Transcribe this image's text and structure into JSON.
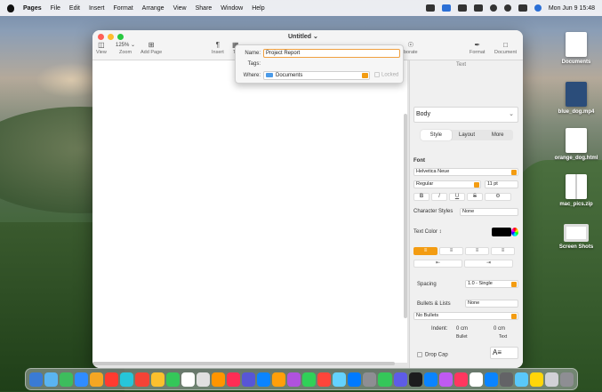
{
  "menubar": {
    "app_name": "Pages",
    "items": [
      "File",
      "Edit",
      "Insert",
      "Format",
      "Arrange",
      "View",
      "Share",
      "Window",
      "Help"
    ],
    "clock": "Mon Jun 9  15:48"
  },
  "window": {
    "title": "Untitled ⌄",
    "toolbar": {
      "view": "View",
      "zoom_value": "125% ⌄",
      "zoom": "Zoom",
      "add_page": "Add Page",
      "insert": "Insert",
      "table_partial": "Ta",
      "collaborate_partial": "borate",
      "format": "Format",
      "document": "Document"
    },
    "save_sheet": {
      "name_label": "Name:",
      "name_value": "Project Report",
      "tags_label": "Tags:",
      "where_label": "Where:",
      "where_value": "Documents",
      "locked_label": "Locked"
    },
    "inspector": {
      "text_tab": "Text",
      "paragraph_style": "Body",
      "tabs": [
        "Style",
        "Layout",
        "More"
      ],
      "font_section": "Font",
      "font_name": "Helvetica Neue",
      "font_weight": "Regular",
      "font_size": "11 pt",
      "bius": [
        "B",
        "I",
        "U",
        "S"
      ],
      "char_styles_label": "Character Styles",
      "char_styles_value": "None",
      "text_color_label": "Text Color ↕",
      "spacing_label": "Spacing",
      "spacing_value": "1.0 - Single",
      "bullets_label": "Bullets & Lists",
      "bullets_value": "None",
      "no_bullets": "No Bullets",
      "indent_label": "Indent:",
      "bullet_indent": "0 cm",
      "text_indent": "0 cm",
      "bullet_caption": "Bullet",
      "text_caption": "Text",
      "drop_cap": "Drop Cap"
    }
  },
  "desktop_icons": [
    {
      "label": "Documents",
      "kind": "doc"
    },
    {
      "label": "blue_dog.mp4",
      "kind": "video"
    },
    {
      "label": "orange_dog.html",
      "kind": "html"
    },
    {
      "label": "mac_pics.zip",
      "kind": "zip"
    },
    {
      "label": "Screen Shots",
      "kind": "folder"
    }
  ],
  "dock_colors": [
    "#3a7bd5",
    "#5ab4f0",
    "#3dbd5d",
    "#2f8cff",
    "#f5a623",
    "#ff3b30",
    "#26c6da",
    "#f44336",
    "#fbc02d",
    "#34c759",
    "#ffffff",
    "#e0e0e0",
    "#ff9500",
    "#ff2d55",
    "#5856d6",
    "#0a84ff",
    "#ff9f0a",
    "#af52de",
    "#30d158",
    "#ff453a",
    "#64d2ff",
    "#007aff",
    "#8e8e93",
    "#34c759",
    "#5e5ce6",
    "#1c1c1e",
    "#0a84ff",
    "#bf5af2",
    "#ff375f",
    "#ffffff",
    "#0a84ff",
    "#636366",
    "#5ac8fa",
    "#ffd60a",
    "#d1d1d6",
    "#8e8e93"
  ]
}
